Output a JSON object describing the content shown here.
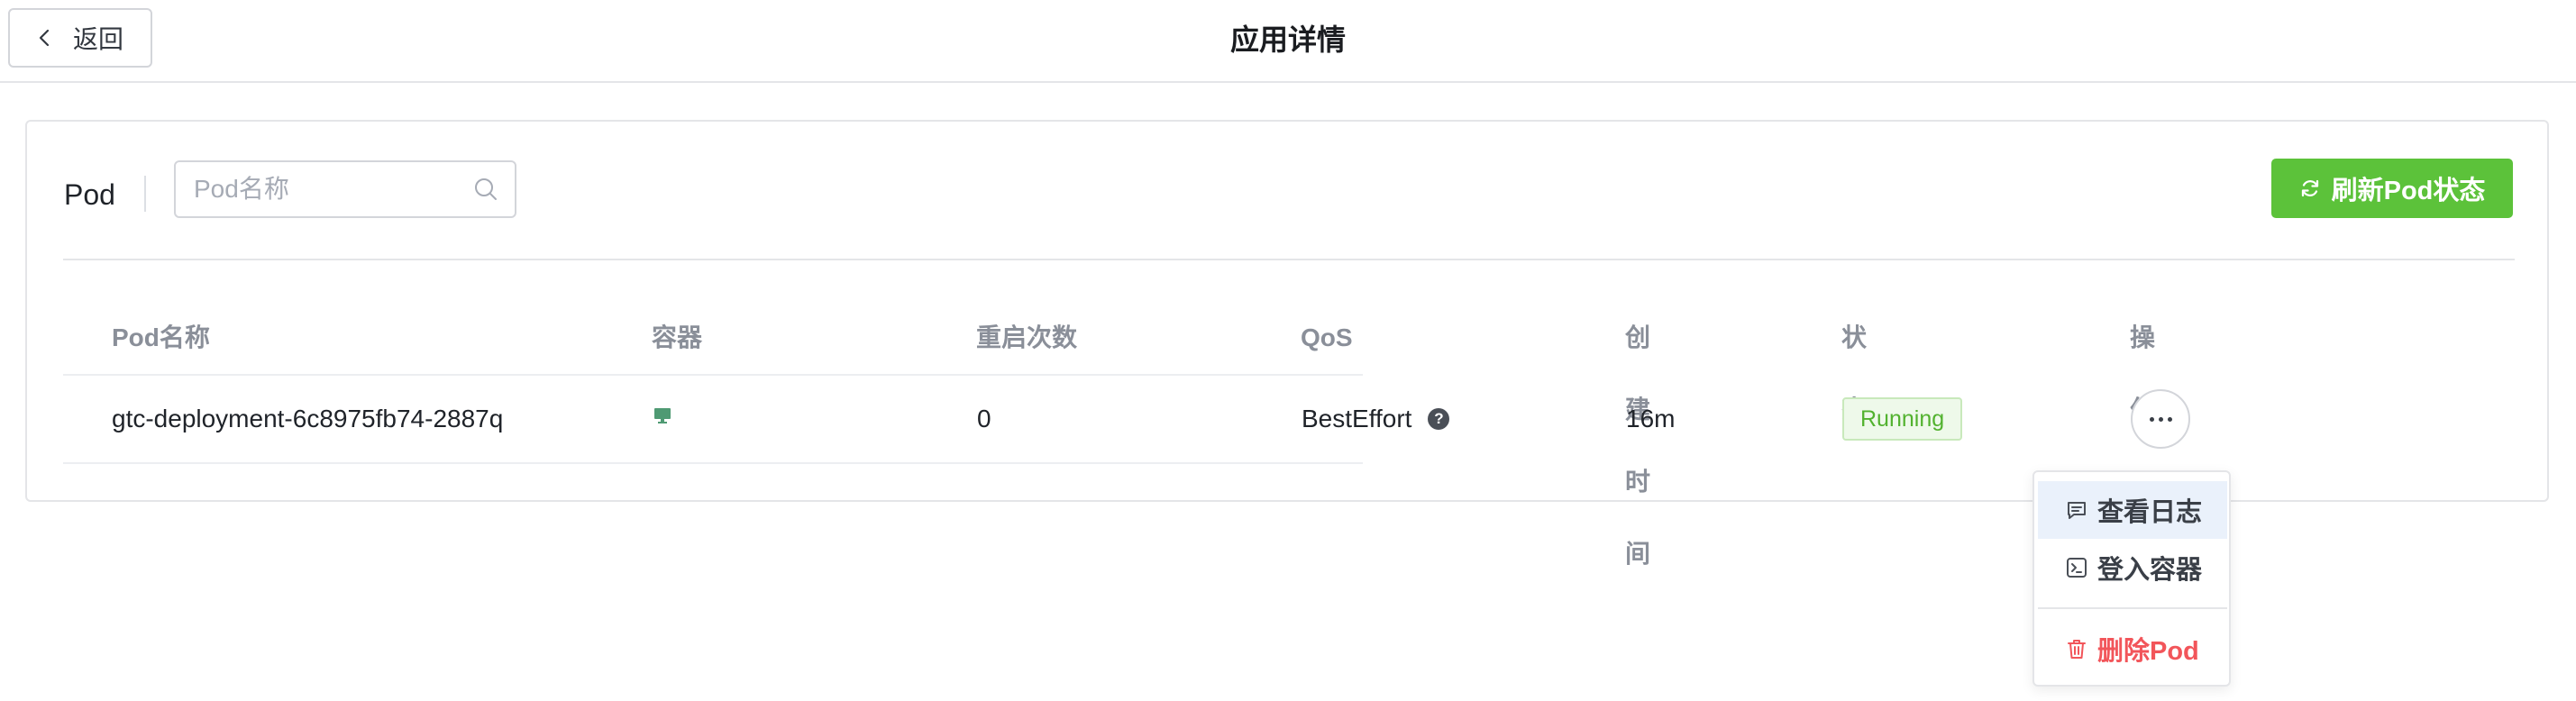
{
  "header": {
    "back_label": "返回",
    "title": "应用详情"
  },
  "toolbar": {
    "section_label": "Pod",
    "search_placeholder": "Pod名称",
    "search_value": "",
    "refresh_label": "刷新Pod状态"
  },
  "table": {
    "columns": [
      "Pod名称",
      "容器",
      "重启次数",
      "QoS",
      "创建时间",
      "状态",
      "操作"
    ],
    "rows": [
      {
        "name": "gtc-deployment-6c8975fb74-2887q",
        "container_icon": "monitor-icon",
        "restarts": "0",
        "qos": "BestEffort",
        "qos_help": "?",
        "created": "16m",
        "status": "Running"
      }
    ]
  },
  "actions_menu": {
    "items": [
      {
        "label": "查看日志",
        "icon": "message-square-icon"
      },
      {
        "label": "登入容器",
        "icon": "terminal-icon"
      },
      {
        "label": "删除Pod",
        "icon": "trash-icon"
      }
    ]
  },
  "colors": {
    "primary_green": "#5cc23a",
    "status_green": "#52b22f",
    "danger_red": "#f2555a",
    "menu_hover": "#eaf1fb"
  }
}
